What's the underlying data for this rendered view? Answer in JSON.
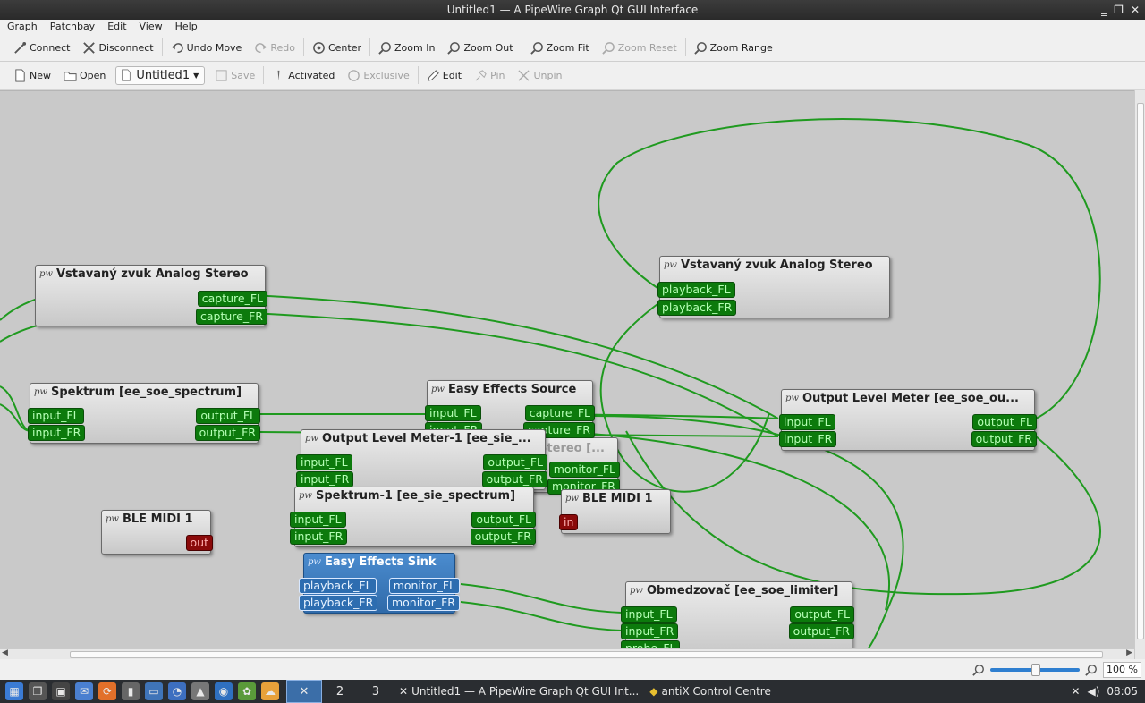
{
  "window": {
    "title": "Untitled1 — A PipeWire Graph Qt GUI Interface"
  },
  "menu": [
    "Graph",
    "Patchbay",
    "Edit",
    "View",
    "Help"
  ],
  "toolbar1": [
    {
      "label": "Connect",
      "icon": "connect-icon",
      "enabled": true
    },
    {
      "label": "Disconnect",
      "icon": "disconnect-icon",
      "enabled": true
    },
    {
      "label": "Undo Move",
      "icon": "undo-icon",
      "enabled": true
    },
    {
      "label": "Redo",
      "icon": "redo-icon",
      "enabled": false
    },
    {
      "label": "Center",
      "icon": "center-icon",
      "enabled": true
    },
    {
      "label": "Zoom In",
      "icon": "zoom-in-icon",
      "enabled": true
    },
    {
      "label": "Zoom Out",
      "icon": "zoom-out-icon",
      "enabled": true
    },
    {
      "label": "Zoom Fit",
      "icon": "zoom-fit-icon",
      "enabled": true
    },
    {
      "label": "Zoom Reset",
      "icon": "zoom-reset-icon",
      "enabled": false
    },
    {
      "label": "Zoom Range",
      "icon": "zoom-range-icon",
      "enabled": true
    }
  ],
  "toolbar2": {
    "new": "New",
    "open": "Open",
    "patchbay_name": "Untitled1",
    "save": "Save",
    "activated": "Activated",
    "exclusive": "Exclusive",
    "edit": "Edit",
    "pin": "Pin",
    "unpin": "Unpin"
  },
  "nodes": {
    "vz_capture": {
      "title": "Vstavaný zvuk Analog Stereo",
      "ports": [
        "capture_FL",
        "capture_FR"
      ]
    },
    "vz_playback": {
      "title": "Vstavaný zvuk Analog Stereo",
      "ports": [
        "playback_FL",
        "playback_FR"
      ]
    },
    "spektrum": {
      "title": "Spektrum [ee_soe_spectrum]",
      "in": [
        "input_FL",
        "input_FR"
      ],
      "out": [
        "output_FL",
        "output_FR"
      ]
    },
    "ee_source": {
      "title": "Easy Effects Source",
      "in": [
        "input_FL",
        "input_FR"
      ],
      "out": [
        "capture_FL",
        "capture_FR"
      ]
    },
    "olm": {
      "title": "Output Level Meter [ee_soe_ou...",
      "in": [
        "input_FL",
        "input_FR"
      ],
      "out": [
        "output_FL",
        "output_FR"
      ]
    },
    "olm1": {
      "title": "Output Level Meter-1 [ee_sie_...",
      "in": [
        "input_FL",
        "input_FR"
      ],
      "out": [
        "output_FL",
        "output_FR"
      ]
    },
    "vz_monitor": {
      "title": "Vstavaný zvuk Analog Stereo [...",
      "ports": [
        "monitor_FL",
        "monitor_FR"
      ]
    },
    "ble_midi_out": {
      "title": "BLE MIDI 1",
      "ports": [
        "out"
      ]
    },
    "ble_midi_in": {
      "title": "BLE MIDI 1",
      "ports": [
        "in"
      ]
    },
    "spektrum1": {
      "title": "Spektrum-1 [ee_sie_spectrum]",
      "in": [
        "input_FL",
        "input_FR"
      ],
      "out": [
        "output_FL",
        "output_FR"
      ]
    },
    "ee_sink": {
      "title": "Easy Effects Sink",
      "in": [
        "playback_FL",
        "playback_FR"
      ],
      "out": [
        "monitor_FL",
        "monitor_FR"
      ]
    },
    "limiter": {
      "title": "Obmedzovač [ee_soe_limiter]",
      "in": [
        "input_FL",
        "input_FR",
        "probe_FL"
      ],
      "out": [
        "output_FL",
        "output_FR"
      ]
    }
  },
  "ghost_title": "Vstavaný zvuk Analog Stereo [...",
  "pw_glyph": "pw",
  "status": {
    "zoom": "100 %",
    "zoom_level": 0.5
  },
  "taskbar": {
    "workspaces": [
      "",
      "2",
      "3"
    ],
    "tasks": [
      "Untitled1 — A PipeWire Graph Qt GUI Int...",
      "antiX Control Centre"
    ],
    "clock": "08:05"
  },
  "colors": {
    "wire": "#1f9a1f",
    "port": "#0c7a0c",
    "midi": "#8a0a0a",
    "selection": "#2f6aa9"
  }
}
